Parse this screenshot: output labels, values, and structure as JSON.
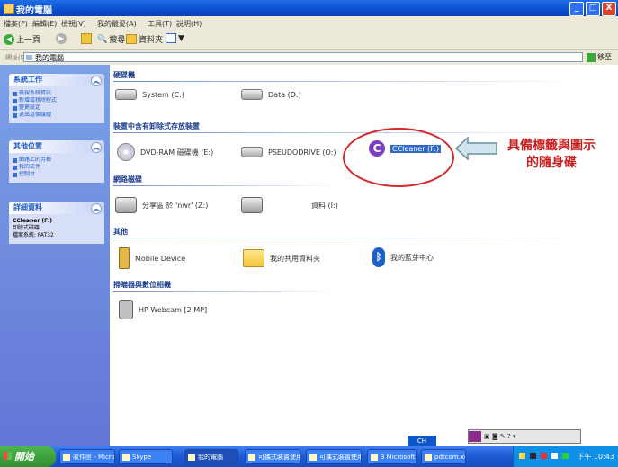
{
  "window": {
    "title": "我的電腦",
    "buttons": {
      "minimize": "_",
      "maximize": "□",
      "close": "X"
    }
  },
  "menu": [
    "檔案(F)",
    "編輯(E)",
    "檢視(V)",
    "我的最愛(A)",
    "工具(T)",
    "說明(H)"
  ],
  "toolbar": {
    "back": "上一頁",
    "search": "搜尋",
    "folders": "資料夾",
    "views": "▼"
  },
  "address": {
    "label": "網址(D)",
    "value": "我的電腦",
    "go": "移至"
  },
  "sidebar": {
    "system_tasks": {
      "title": "系統工作",
      "items": [
        "檢視系統資訊",
        "新增或移除程式",
        "變更設定",
        "退出這個媒體"
      ]
    },
    "other_places": {
      "title": "其他位置",
      "items": [
        "網路上的芳鄰",
        "我的文件",
        "控制台"
      ]
    },
    "details": {
      "title": "詳細資料",
      "name": "CCleaner (F:)",
      "type": "卸除式磁碟",
      "fs": "檔案系統: FAT32"
    }
  },
  "sections": {
    "hard_disks": "硬碟機",
    "removable": "裝置中含有卸除式存放裝置",
    "network": "網路磁碟",
    "other": "其他",
    "scanners": "掃瞄器與數位相機"
  },
  "drives": {
    "system": "System (C:)",
    "data": "Data (D:)",
    "dvd": "DVD-RAM 磁碟機 (E:)",
    "pseudo": "PSEUDODRIVE (O:)",
    "ccleaner": "CCleaner (F:)",
    "share_z": "分享區 於 'nwr' (Z:)",
    "share_2": "資料 (I:)",
    "mobile": "Mobile Device",
    "shared_docs": "我的共用資料夾",
    "bluetooth": "我的藍芽中心",
    "webcam": "HP Webcam [2 MP]"
  },
  "callout": {
    "line1": "具備標籤與圖示",
    "line2": "的隨身碟"
  },
  "taskbar": {
    "start": "開始",
    "tasks": [
      "收件匣 - Microsoft...",
      "Skype",
      "我的電腦",
      "可攜式裝置使用...",
      "可攜式裝置使用...",
      "3 Microsoft Offi...",
      "pdtcom.xd - 記事本"
    ],
    "ime": "CH",
    "clock": "下午 10:43"
  },
  "colors": {
    "titlebar": "#0a4fd0",
    "sidebar": "#6f8cd9",
    "callout": "#c81e1e",
    "oval": "#d42a2a",
    "taskbar": "#1f5bd6",
    "start": "#2e8f2e"
  }
}
